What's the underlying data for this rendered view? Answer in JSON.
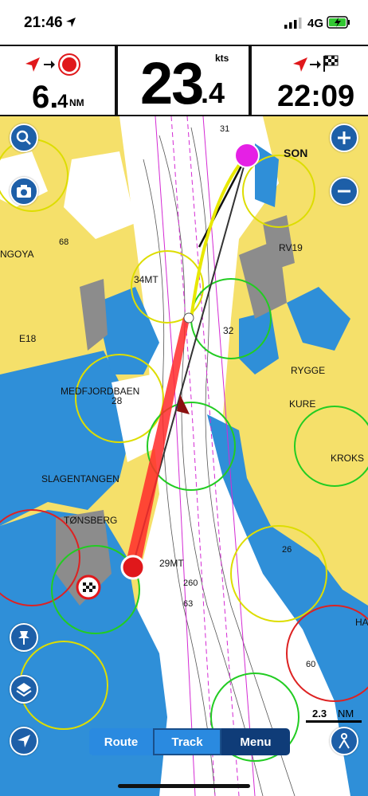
{
  "status_bar": {
    "time": "21:46",
    "network": "4G"
  },
  "speed_panel": {
    "value_int": "6.",
    "value_dec": "4",
    "unit": "NM"
  },
  "center_panel": {
    "value_int": "23",
    "value_dec": ".4",
    "unit": "kts"
  },
  "eta_panel": {
    "value": "22:09"
  },
  "map": {
    "place_labels": [
      "SON",
      "RV19",
      "NGOYA",
      "E18",
      "34MT",
      "32",
      "RYGGE",
      "KURE",
      "MEDFJORDBAEN",
      "28",
      "KROKS",
      "SLAGENTANGEN",
      "TØNSBERG",
      "29MT",
      "260",
      "63",
      "26",
      "HA",
      "68",
      "31",
      "60"
    ],
    "scale_label": "2.3",
    "scale_unit": "NM"
  },
  "bottom_tabs": {
    "route": "Route",
    "track": "Track",
    "menu": "Menu"
  },
  "colors": {
    "land": "#f5e06a",
    "water_deep": "#ffffff",
    "water_shallow": "#2f8fd8",
    "button": "#1d5fa8",
    "track": "#ff2a2a"
  }
}
